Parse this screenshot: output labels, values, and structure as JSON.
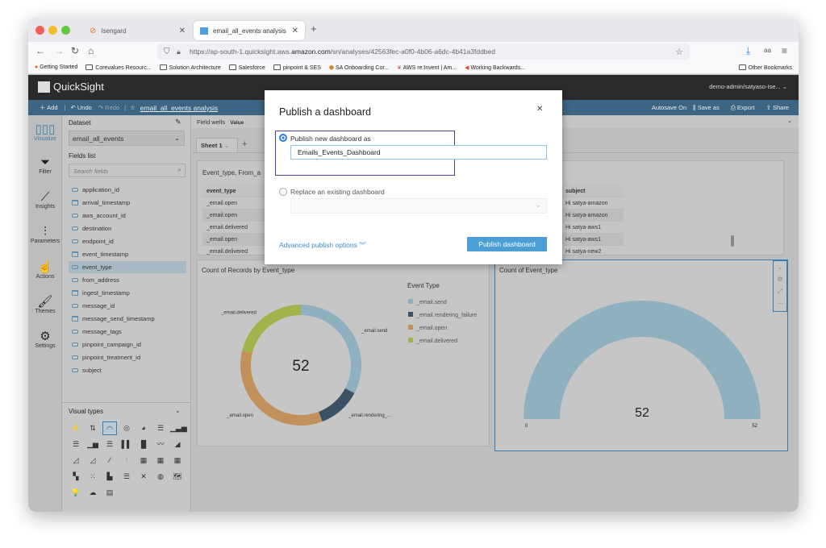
{
  "browser": {
    "tabs": [
      {
        "label": "Isengard"
      },
      {
        "label": "email_all_events analysis"
      }
    ],
    "url_prefix": "https://ap-south-1.quicksight.aws.",
    "url_domain": "amazon.com",
    "url_suffix": "/sn/analyses/42563fec-a0f0-4b06-a6dc-4b41a3fddbed",
    "bookmarks": [
      "Getting Started",
      "Corevalues Resourc...",
      "Solution Architecture",
      "Salesforce",
      "pinpoint & SES",
      "SA Onboarding Cor...",
      "AWS re:Invent | Am...",
      "Working Backwards..."
    ],
    "other_bookmarks": "Other Bookmarks"
  },
  "app": {
    "name": "QuickSight",
    "user": "demo-admin/satyaso-Ise..."
  },
  "toolbar": {
    "add": "Add",
    "undo": "Undo",
    "redo": "Redo",
    "analysis_name": "email_all_events analysis",
    "autosave": "Autosave On",
    "save_as": "Save as",
    "export": "Export",
    "share": "Share"
  },
  "rail": [
    {
      "label": "Visualize"
    },
    {
      "label": "Filter"
    },
    {
      "label": "Insights"
    },
    {
      "label": "Parameters"
    },
    {
      "label": "Actions"
    },
    {
      "label": "Themes"
    },
    {
      "label": "Settings"
    }
  ],
  "fields_panel": {
    "dataset_label": "Dataset",
    "dataset": "email_all_events",
    "fields_label": "Fields list",
    "search_placeholder": "Search fields",
    "fields": [
      {
        "name": "application_id",
        "type": "text"
      },
      {
        "name": "arrival_timestamp",
        "type": "date"
      },
      {
        "name": "aws_account_id",
        "type": "text"
      },
      {
        "name": "destination",
        "type": "text"
      },
      {
        "name": "endpoint_id",
        "type": "text"
      },
      {
        "name": "event_timestamp",
        "type": "date"
      },
      {
        "name": "event_type",
        "type": "text",
        "selected": true
      },
      {
        "name": "from_address",
        "type": "text"
      },
      {
        "name": "ingest_timestamp",
        "type": "date"
      },
      {
        "name": "message_id",
        "type": "text"
      },
      {
        "name": "message_send_timestamp",
        "type": "date"
      },
      {
        "name": "message_tags",
        "type": "text"
      },
      {
        "name": "pinpoint_campaign_id",
        "type": "text"
      },
      {
        "name": "pinpoint_treatment_id",
        "type": "text"
      },
      {
        "name": "subject",
        "type": "text"
      }
    ],
    "visual_types_label": "Visual types"
  },
  "canvas": {
    "field_wells": "Field wells",
    "value": "Value",
    "sheet": "Sheet 1",
    "table": {
      "title": "Event_type, From_a",
      "col1": "event_type",
      "col1_rows": [
        "_email.open",
        "_email.open",
        "_email.delivered",
        "_email.open",
        "_email.delivered"
      ],
      "col2": "subject",
      "col2_rows": [
        "Hi satya-amazon",
        "Hi satya-amazon",
        "Hi satya-aws1",
        "Hi satya-aws1",
        "Hi satya-new2"
      ]
    }
  },
  "chart_data": [
    {
      "type": "pie",
      "title": "Count of Records by Event_type",
      "legend_title": "Event Type",
      "legend_position": "right",
      "total_label": "52",
      "categories": [
        "_email.send",
        "_email.rendering_failure",
        "_email.open",
        "_email.delivered"
      ],
      "slice_labels": [
        "_email.send",
        "_email.rendering_...",
        "_email.open",
        "_email.delivered"
      ],
      "values": [
        17,
        6,
        18,
        11
      ],
      "colors": [
        "#8fb1bf",
        "#3b5266",
        "#c2905a",
        "#a3b34c"
      ]
    },
    {
      "type": "gauge",
      "title": "Count of Event_type",
      "value": 52,
      "value_label": "52",
      "min_label": "0",
      "max_label": "52",
      "range": [
        0,
        52
      ],
      "color": "#8fb1bf"
    }
  ],
  "modal": {
    "title": "Publish a dashboard",
    "option_new": "Publish new dashboard as",
    "dashboard_name": "Emails_Events_Dashboard",
    "option_replace": "Replace an existing dashboard",
    "advanced": "Advanced publish options",
    "publish": "Publish dashboard"
  }
}
